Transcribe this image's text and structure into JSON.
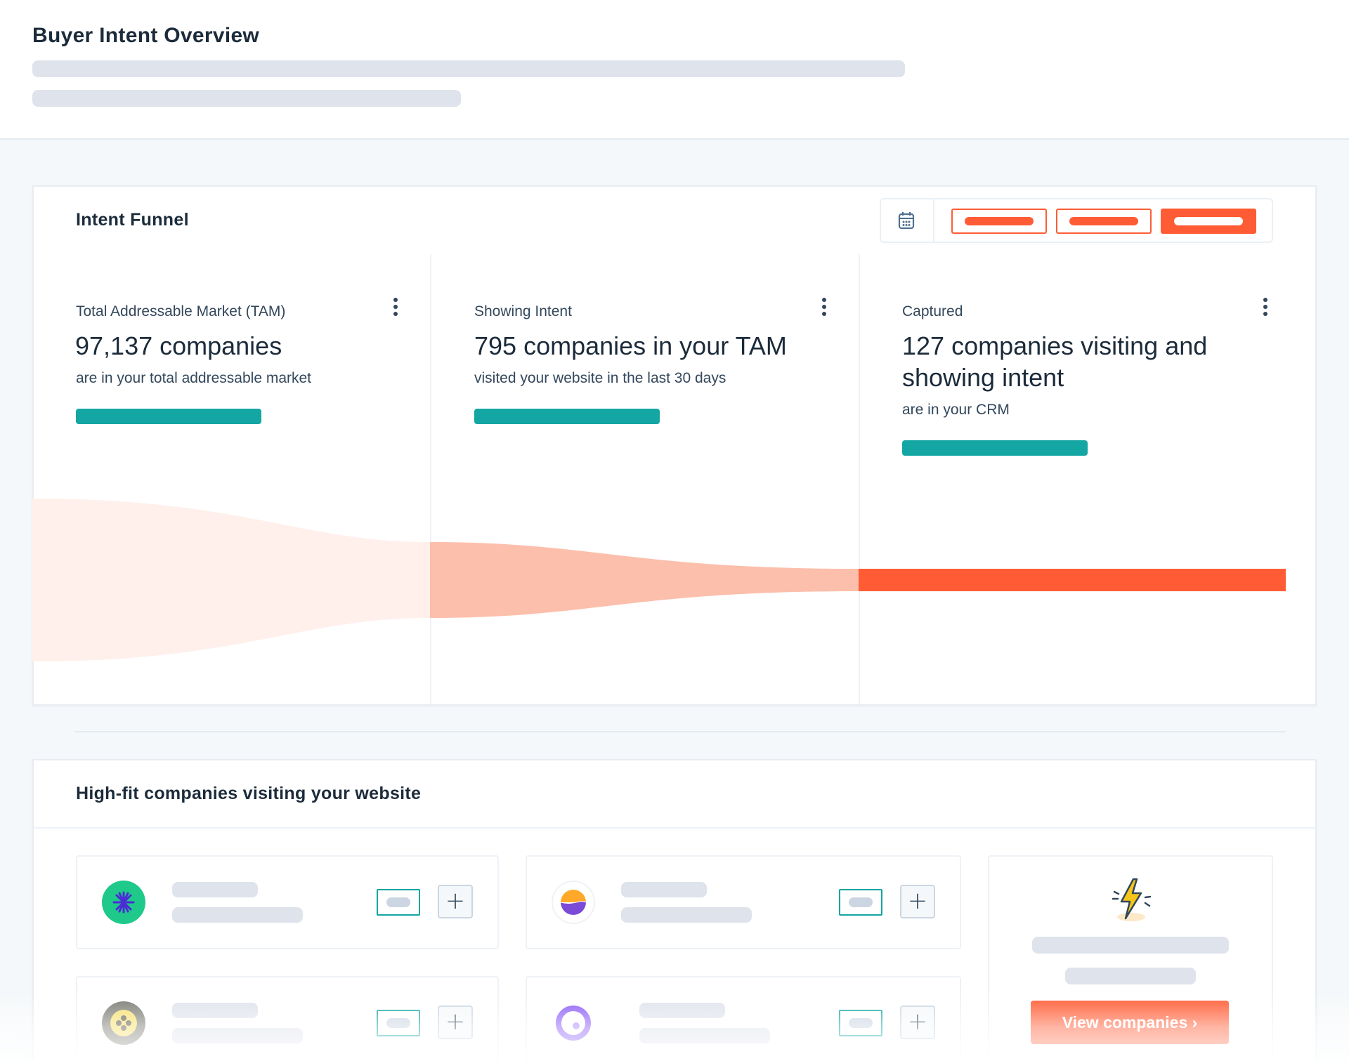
{
  "header": {
    "title": "Buyer Intent Overview"
  },
  "funnel_card": {
    "title": "Intent Funnel",
    "date_icon": "calendar-icon",
    "range_options": 3,
    "active_range_index": 2,
    "stages": [
      {
        "label": "Total Addressable Market (TAM)",
        "value": "97,137 companies",
        "description": "are in your total addressable market",
        "menu_icon": "kebab-menu-icon"
      },
      {
        "label": "Showing Intent",
        "value": "795 companies in your TAM",
        "description": "visited your website in the last 30 days",
        "menu_icon": "kebab-menu-icon"
      },
      {
        "label": "Captured",
        "value": "127 companies visiting and showing intent",
        "description": "are in your CRM",
        "menu_icon": "kebab-menu-icon"
      }
    ]
  },
  "companies_card": {
    "title": "High-fit companies visiting your website",
    "add_label": "+",
    "companies": [
      {
        "logo_icon": "green-star-logo-icon"
      },
      {
        "logo_icon": "orange-purple-logo-icon"
      },
      {
        "logo_icon": "gray-yellow-logo-icon"
      },
      {
        "logo_icon": "purple-ring-logo-icon"
      }
    ],
    "promo_icon": "lightning-bolt-icon",
    "view_button_label": "View companies ›"
  },
  "colors": {
    "accent": "#ff5c35",
    "teal": "#13a6a3",
    "skeleton": "#dfe3eb",
    "funnel_light": "#fff0ec",
    "funnel_mid": "#fcbfab"
  }
}
